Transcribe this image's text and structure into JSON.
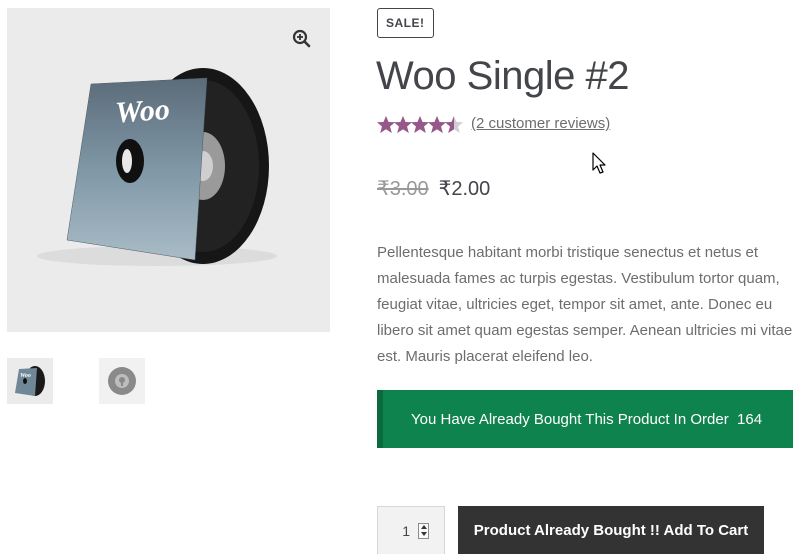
{
  "gallery": {
    "main_image_alt": "Woo Single #2",
    "cover_text": "Woo",
    "thumbnails": [
      "Woo vinyl album cover",
      "vinyl record"
    ]
  },
  "product": {
    "sale_badge": "SALE!",
    "title": "Woo Single #2",
    "rating": 4.5,
    "rating_max": 5,
    "reviews_link": "(2 customer reviews)",
    "price_old": "₹3.00",
    "price_new": "₹2.00",
    "description": "Pellentesque habitant morbi tristique senectus et netus et malesuada fames ac turpis egestas. Vestibulum tortor quam, feugiat vitae, ultricies eget, tempor sit amet, ante. Donec eu libero sit amet quam egestas semper. Aenean ultricies mi vitae est. Mauris placerat eleifend leo."
  },
  "notice": {
    "text": "You Have Already Bought This Product In Order",
    "order_number": "164"
  },
  "cart": {
    "quantity": "1",
    "button_label": "Product Already Bought !! Add To Cart"
  },
  "colors": {
    "star": "#96588a",
    "notice_bg": "#0f834d",
    "button_bg": "#333333"
  }
}
